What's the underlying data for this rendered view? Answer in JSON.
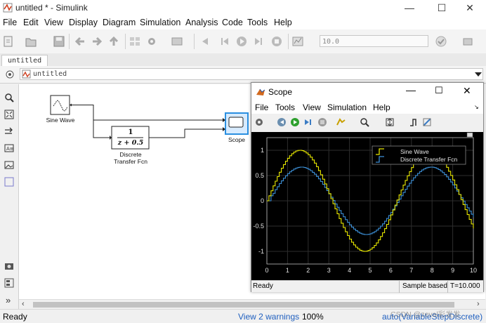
{
  "window": {
    "title": "untitled * - Simulink"
  },
  "menu": [
    "File",
    "Edit",
    "View",
    "Display",
    "Diagram",
    "Simulation",
    "Analysis",
    "Code",
    "Tools",
    "Help"
  ],
  "toolbar": {
    "stop_time": "10.0"
  },
  "tabs": [
    "untitled"
  ],
  "address": {
    "path": "untitled"
  },
  "blocks": {
    "sine": "Sine Wave",
    "discrete_line1": "Discrete",
    "discrete_line2": "Transfer Fcn",
    "tf_num": "1",
    "tf_den": "z + 0.5",
    "scope": "Scope"
  },
  "status": {
    "left": "Ready",
    "warnings": "View 2 warnings",
    "zoom": "100%",
    "solver": "auto(VariableStepDiscrete)",
    "watermark": "CSDN @zeval彩发发"
  },
  "scope_window": {
    "title": "Scope",
    "menu": [
      "File",
      "Tools",
      "View",
      "Simulation",
      "Help"
    ],
    "status": "Ready",
    "sample_based": "Sample based",
    "time": "T=10.000"
  },
  "colors": {
    "sine": "#e8e800",
    "tf": "#3c8fd6",
    "plot_bg": "#000000",
    "axis": "#bfbfbf"
  },
  "chart_data": {
    "type": "line",
    "x_range": [
      0,
      10
    ],
    "y_range": [
      -1.25,
      1.25
    ],
    "xticks": [
      0,
      1,
      2,
      3,
      4,
      5,
      6,
      7,
      8,
      9,
      10
    ],
    "yticks": [
      1,
      0.5,
      0,
      -0.5,
      -1
    ],
    "ytick_labels": [
      "1",
      "0.5",
      "0",
      "-0.5",
      "-1"
    ],
    "legend": "top-right",
    "grid": true,
    "step_samples": 0.1,
    "series": [
      {
        "name": "Sine Wave",
        "color": "#e8e800",
        "amplitude": 1,
        "note": "stair-step"
      },
      {
        "name": "Discrete Transfer Fcn",
        "color": "#3c8fd6",
        "amplitude": 0.667,
        "note": "stair-step"
      }
    ]
  }
}
